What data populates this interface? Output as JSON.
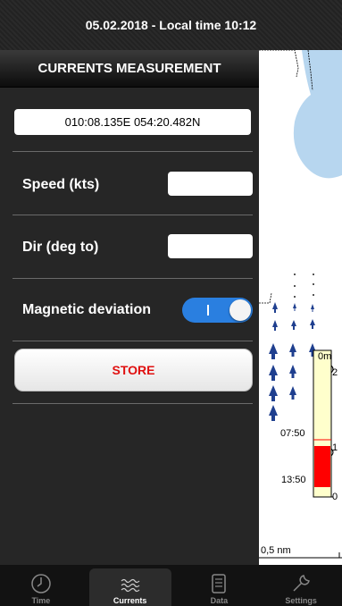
{
  "header": {
    "title": "05.02.2018 - Local time 10:12"
  },
  "panel": {
    "title": "CURRENTS MEASUREMENT",
    "position": "010:08.135E  054:20.482N",
    "speed": {
      "label": "Speed (kts)",
      "value": ""
    },
    "direction": {
      "label": "Dir (deg to)",
      "value": ""
    },
    "magnetic_deviation": {
      "label": "Magnetic deviation",
      "enabled": true
    },
    "store_label": "STORE"
  },
  "map": {
    "scale_label": "0,5 nm",
    "tide_zero_label": "0m",
    "tide_tick_2": "2",
    "tide_tick_1": "1",
    "tide_tick_0": "0",
    "tide_time_1": "07:50",
    "tide_time_2": "13:50",
    "colors": {
      "water": "#b7d6ef",
      "arrow": "#1f3f8f",
      "tide_fill": "#ffffcc",
      "tide_bar": "#ff0000"
    }
  },
  "tabs": [
    {
      "label": "Time",
      "icon": "clock-icon",
      "active": false
    },
    {
      "label": "Currents",
      "icon": "waves-icon",
      "active": true
    },
    {
      "label": "Data",
      "icon": "document-icon",
      "active": false
    },
    {
      "label": "Settings",
      "icon": "wrench-icon",
      "active": false
    }
  ]
}
